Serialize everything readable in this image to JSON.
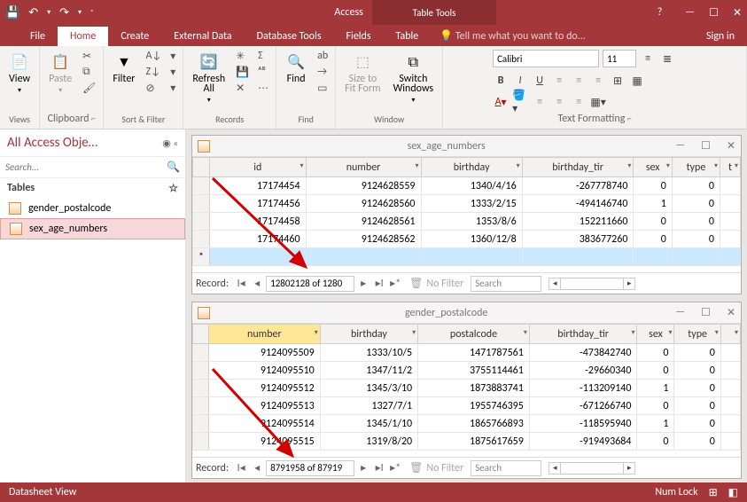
{
  "title": {
    "app": "Access",
    "context": "Table Tools",
    "signin": "Sign in"
  },
  "qat": {
    "save": "💾",
    "undo": "↶",
    "redo": "↷"
  },
  "winbtns": {
    "help": "?",
    "min": "—",
    "max": "☐",
    "close": "✕"
  },
  "tabs": {
    "file": "File",
    "home": "Home",
    "create": "Create",
    "external": "External Data",
    "dbtools": "Database Tools",
    "fields": "Fields",
    "table": "Table",
    "tellme": "Tell me what you want to do..."
  },
  "ribbon": {
    "views": {
      "label": "Views",
      "view": "View"
    },
    "clipboard": {
      "label": "Clipboard",
      "paste": "Paste"
    },
    "sortfilter": {
      "label": "Sort & Filter",
      "filter": "Filter"
    },
    "records": {
      "label": "Records",
      "refresh": "Refresh\nAll"
    },
    "find": {
      "label": "Find",
      "find": "Find"
    },
    "window": {
      "label": "Window",
      "size": "Size to\nFit Form",
      "switch": "Switch\nWindows"
    },
    "textfmt": {
      "label": "Text Formatting",
      "font": "Calibri",
      "size": "11"
    }
  },
  "sidebar": {
    "title": "All Access Obje…",
    "search": "Search...",
    "section": "Tables",
    "items": [
      "gender_postalcode",
      "sex_age_numbers"
    ]
  },
  "table1": {
    "title": "sex_age_numbers",
    "headers": [
      "id",
      "number",
      "birthday",
      "birthday_tir",
      "sex",
      "type",
      "t"
    ],
    "rows": [
      [
        "17174454",
        "9124628559",
        "1340/4/16",
        "-267778740",
        "0",
        "0",
        ""
      ],
      [
        "17174456",
        "9124628560",
        "1333/2/15",
        "-494146740",
        "1",
        "0",
        ""
      ],
      [
        "17174458",
        "9124628561",
        "1353/8/6",
        "152211660",
        "0",
        "0",
        ""
      ],
      [
        "17174460",
        "9124628562",
        "1360/12/8",
        "383677260",
        "0",
        "0",
        ""
      ]
    ],
    "nav": "12802128 of 1280"
  },
  "table2": {
    "title": "gender_postalcode",
    "headers": [
      "number",
      "birthday",
      "postalcode",
      "birthday_tir",
      "sex",
      "type",
      ""
    ],
    "rows": [
      [
        "9124095509",
        "1333/10/5",
        "1471787561",
        "-473842740",
        "0",
        "0",
        ""
      ],
      [
        "9124095510",
        "1347/11/2",
        "3755114461",
        "-29660340",
        "0",
        "0",
        ""
      ],
      [
        "9124095512",
        "1345/3/10",
        "1873883741",
        "-113209140",
        "1",
        "0",
        ""
      ],
      [
        "9124095513",
        "1327/7/1",
        "1955746395",
        "-671266740",
        "0",
        "0",
        ""
      ],
      [
        "9124095514",
        "1345/1/10",
        "1865766893",
        "-118595940",
        "1",
        "0",
        ""
      ],
      [
        "9124095515",
        "1319/8/20",
        "1875617659",
        "-919493684",
        "0",
        "0",
        ""
      ]
    ],
    "nav": "8791958 of 87919"
  },
  "navcommon": {
    "record": "Record:",
    "nofilter": "No Filter",
    "search": "Search"
  },
  "status": {
    "view": "Datasheet View",
    "numlock": "Num Lock"
  }
}
